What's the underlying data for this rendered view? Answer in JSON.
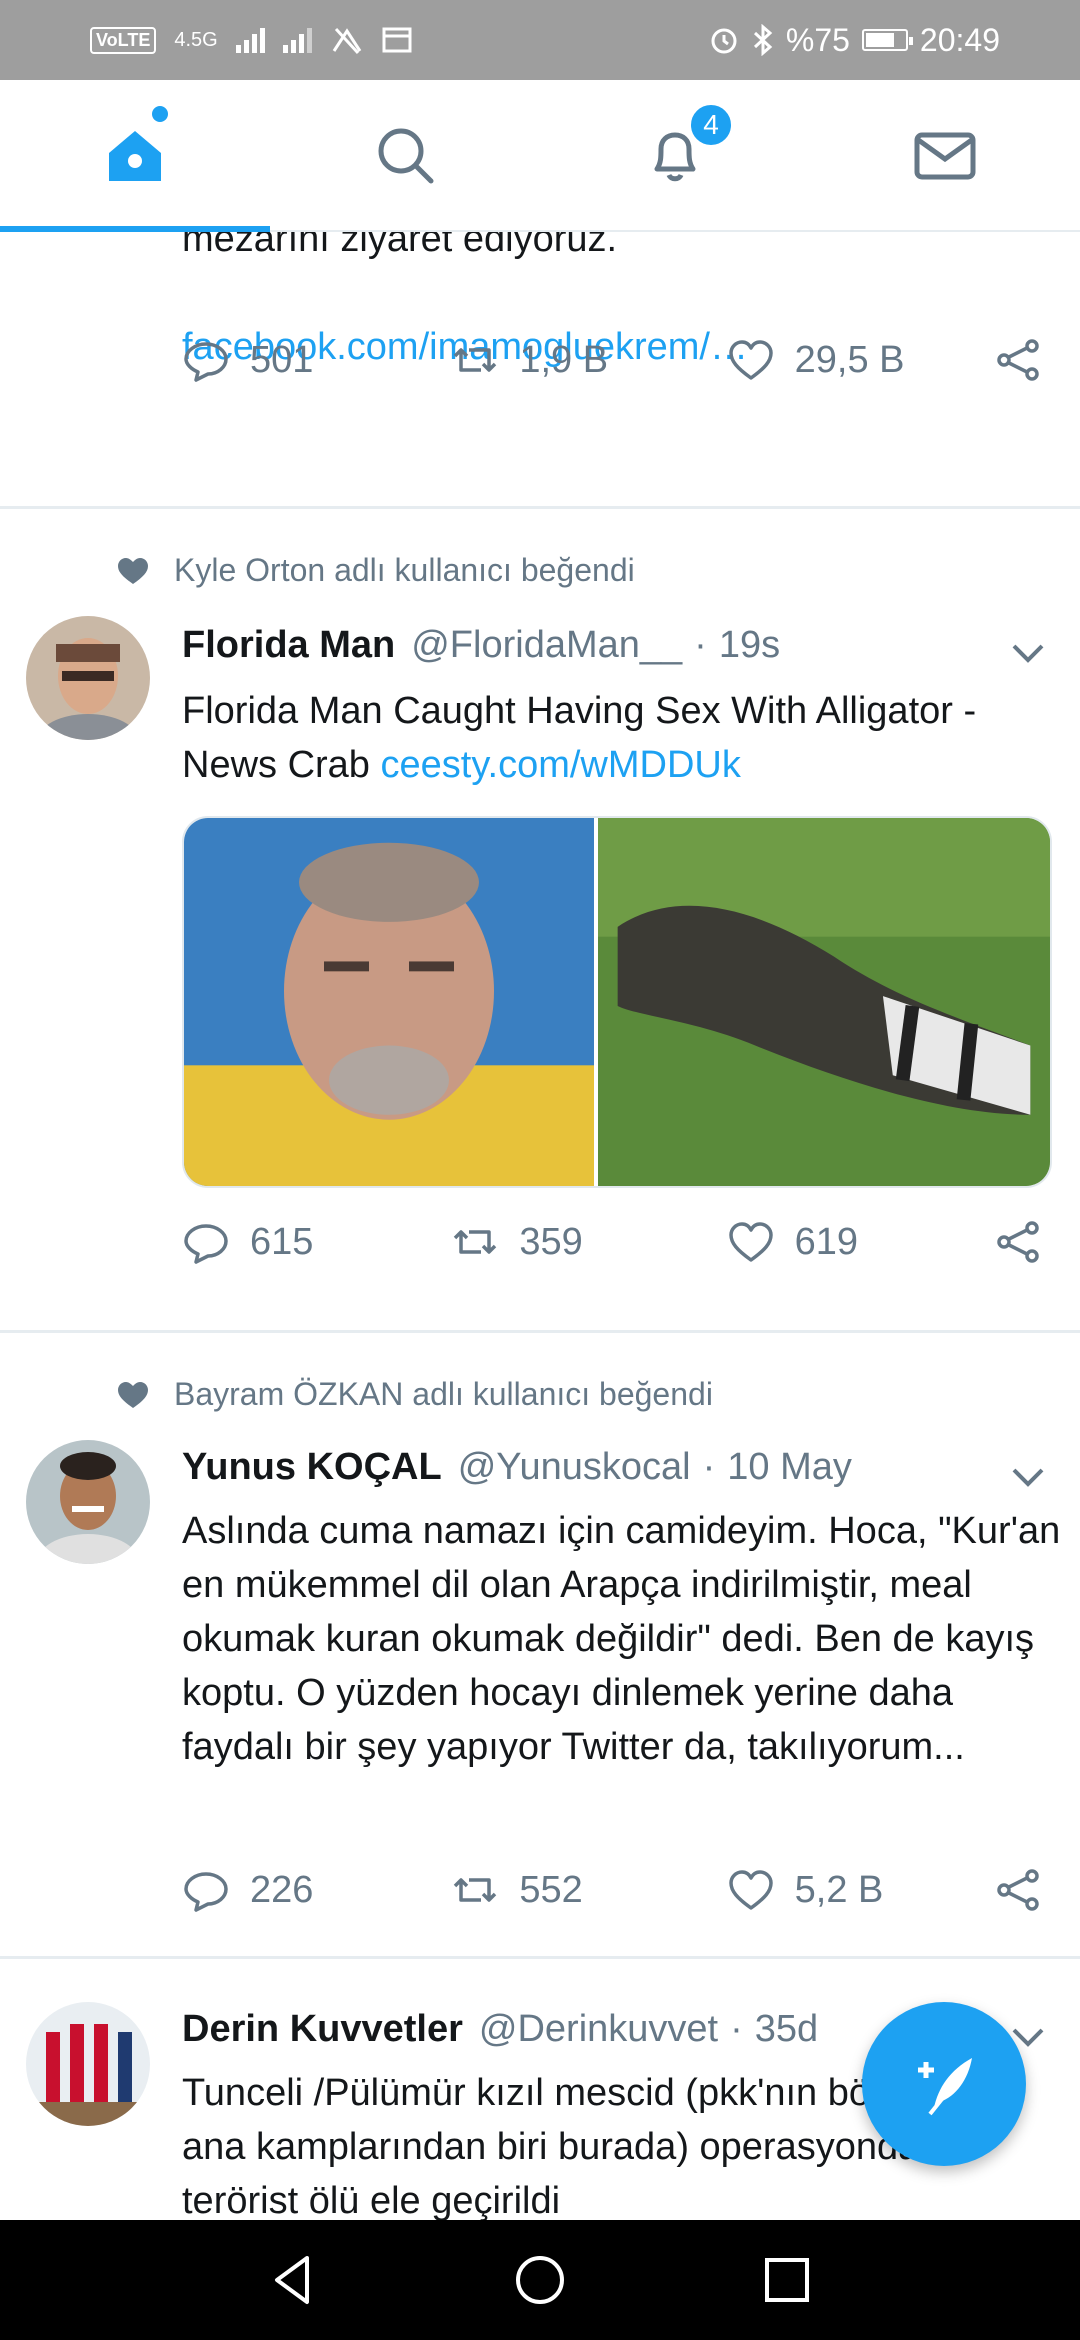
{
  "status_bar": {
    "volte": "VoLTE",
    "network": "4.5G",
    "battery": "%75",
    "battery_level": 0.75,
    "time": "20:49"
  },
  "nav": {
    "tabs": [
      "home",
      "search",
      "notifications",
      "messages"
    ],
    "notification_count": "4",
    "active_tab": "home"
  },
  "partial_tweet": {
    "text": "mezarını ziyaret ediyoruz.",
    "link": "facebook.com/imamogluekrem/…",
    "replies": "501",
    "retweets": "1,9 B",
    "likes": "29,5 B"
  },
  "tweets": [
    {
      "social_context": "Kyle Orton adlı kullanıcı beğendi",
      "name": "Florida Man",
      "handle": "@FloridaMan__",
      "separator": "·",
      "time": "19s",
      "text": "Florida Man Caught Having Sex With Alligator - News Crab ",
      "link": "ceesty.com/wMDDUk",
      "replies": "615",
      "retweets": "359",
      "likes": "619"
    },
    {
      "social_context": "Bayram ÖZKAN adlı kullanıcı beğendi",
      "name": "Yunus KOÇAL",
      "handle": "@Yunuskocal",
      "separator": "·",
      "time": "10 May",
      "text": "Aslında cuma namazı için camideyim. Hoca, \"Kur'an en mükemmel dil olan Arapça indirilmiştir, meal okumak kuran okumak değildir\" dedi. Ben de kayış koptu. O yüzden hocayı dinlemek yerine daha faydalı bir şey yapıyor Twitter da, takılıyorum...",
      "replies": "226",
      "retweets": "552",
      "likes": "5,2 B"
    },
    {
      "name": "Derin Kuvvetler",
      "handle": "@Derinkuvvet",
      "separator": "·",
      "time": "35d",
      "text": "Tunceli /Pülümür kızıl mescid (pkk'nın bölgedeki ana kamplarından biri burada) operasyonda 1 terörist ölü ele geçirildi"
    }
  ],
  "icons": {
    "reply": "reply-icon",
    "retweet": "retweet-icon",
    "like": "heart-icon",
    "share": "share-icon",
    "compose": "compose-tweet-icon"
  },
  "colors": {
    "accent": "#1da1f2",
    "secondary_text": "#657786",
    "status_bar": "#9e9e9e"
  }
}
